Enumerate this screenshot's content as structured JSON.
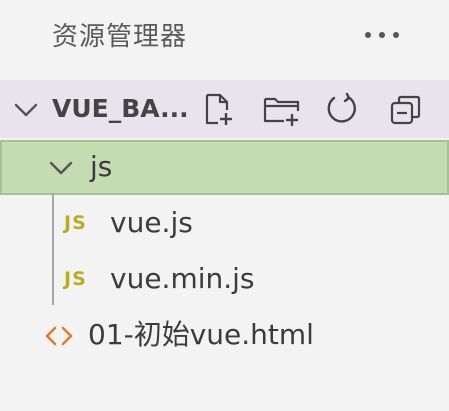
{
  "explorer": {
    "title": "资源管理器",
    "more_label": "···"
  },
  "section": {
    "title": "VUE_BA...",
    "actions": [
      {
        "icon": "new-file-icon"
      },
      {
        "icon": "new-folder-icon"
      },
      {
        "icon": "refresh-icon"
      },
      {
        "icon": "collapse-all-icon"
      }
    ]
  },
  "tree": {
    "folder": {
      "label": "js",
      "icon": "chevron-down-icon"
    },
    "files": [
      {
        "label": "vue.js",
        "badge": "JS"
      },
      {
        "label": "vue.min.js",
        "badge": "JS"
      }
    ],
    "html_file": {
      "label": "01-初始vue.html",
      "icon": "html-code-icon"
    }
  },
  "colors": {
    "background": "#f3f3f3",
    "section_header": "#e9e4ec",
    "selected_row": "#c5dbb2",
    "selected_border": "#a7c292",
    "js_badge": "#b8ac24",
    "html_icon": "#e37933"
  }
}
